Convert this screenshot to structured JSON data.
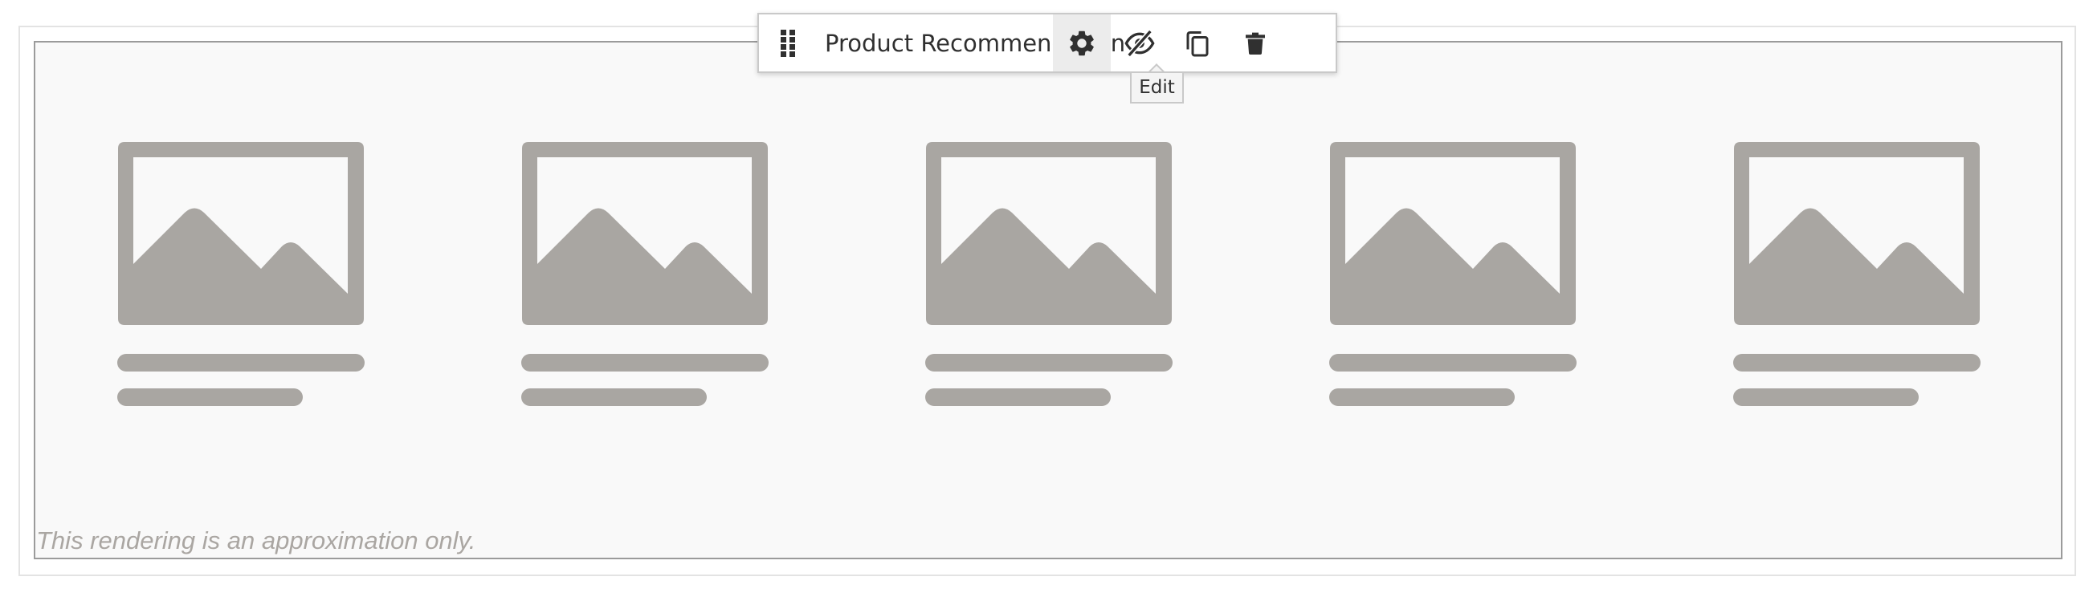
{
  "toolbar": {
    "title": "Product Recommendation",
    "handle_icon": "drag-handle-icon",
    "buttons": [
      {
        "name": "edit",
        "icon": "gear-icon"
      },
      {
        "name": "hide",
        "icon": "eye-slash-icon"
      },
      {
        "name": "duplicate",
        "icon": "copy-icon"
      },
      {
        "name": "delete",
        "icon": "trash-icon"
      }
    ],
    "tooltip": "Edit"
  },
  "widget": {
    "placeholder_count": 5,
    "placeholder_icon": "image-placeholder-icon",
    "disclaimer": "This rendering is an approximation only."
  },
  "colors": {
    "placeholder": "#a9a6a2",
    "canvas_bg": "#f9f9f9",
    "border": "#9b9b9b"
  }
}
